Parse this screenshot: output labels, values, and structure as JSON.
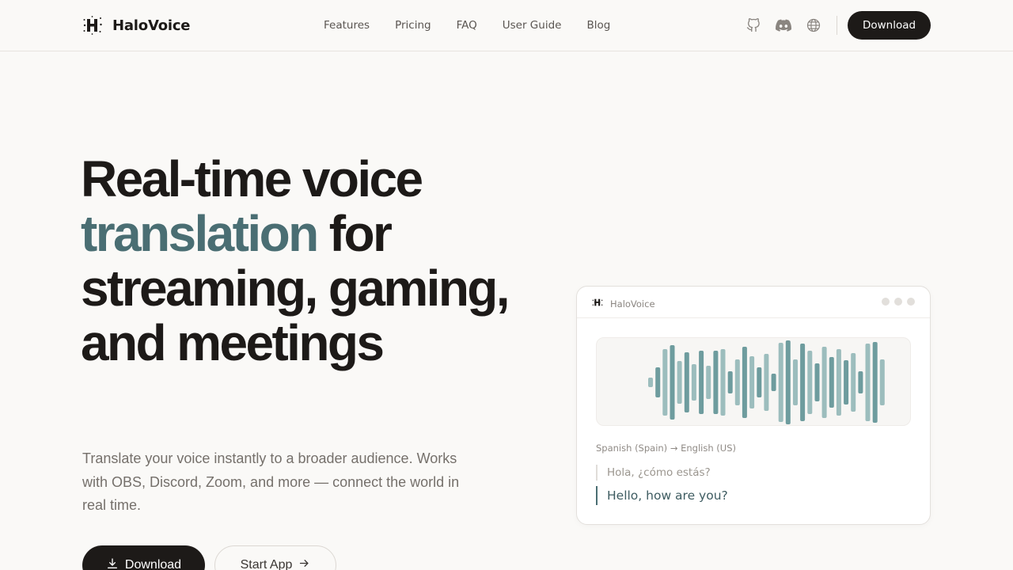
{
  "header": {
    "brand_name": "HaloVoice",
    "nav": [
      {
        "label": "Features"
      },
      {
        "label": "Pricing"
      },
      {
        "label": "FAQ"
      },
      {
        "label": "User Guide"
      },
      {
        "label": "Blog"
      }
    ],
    "icons": [
      "github-icon",
      "discord-icon",
      "globe-icon"
    ],
    "download_label": "Download"
  },
  "hero": {
    "title_line1": "Real-time voice",
    "title_accent": "translation",
    "title_rest": " for streaming, gaming, and meetings",
    "subtitle": "Translate your voice instantly to a broader audience. Works with OBS, Discord, Zoom, and more — connect the world in real time.",
    "download_label": "Download",
    "start_label": "Start App"
  },
  "card": {
    "brand_name": "HaloVoice",
    "lang_from": "Spanish (Spain)",
    "lang_arrow": "→",
    "lang_to": "English (US)",
    "source_text": "Hola, ¿cómo estás?",
    "translated_text": "Hello, how are you?"
  },
  "colors": {
    "accent": "#4a6e73",
    "dark": "#1d1a18",
    "wave_dark": "#6e9c9e",
    "wave_light": "#9cbdbd"
  }
}
